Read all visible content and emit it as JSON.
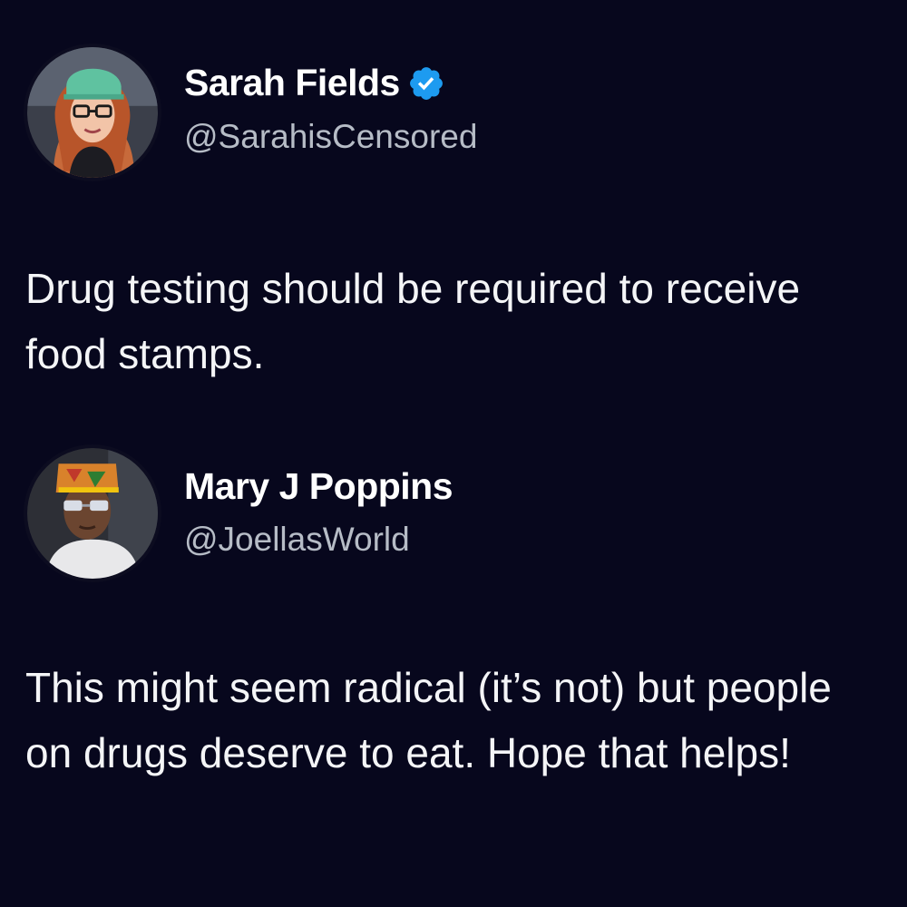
{
  "tweets": [
    {
      "author_name": "Sarah Fields",
      "handle": "@SarahisCensored",
      "verified": true,
      "text": "Drug testing should be required to receive food stamps."
    },
    {
      "author_name": "Mary J Poppins",
      "handle": "@JoellasWorld",
      "verified": false,
      "text": "This might seem radical (it’s not) but people on drugs deserve to eat. Hope that helps!"
    }
  ],
  "icons": {
    "verified": "verified-badge-icon"
  },
  "colors": {
    "background": "#07071d",
    "verified_badge": "#1d9bf0",
    "handle": "#b6bcc6",
    "text": "#f4f5f7"
  }
}
